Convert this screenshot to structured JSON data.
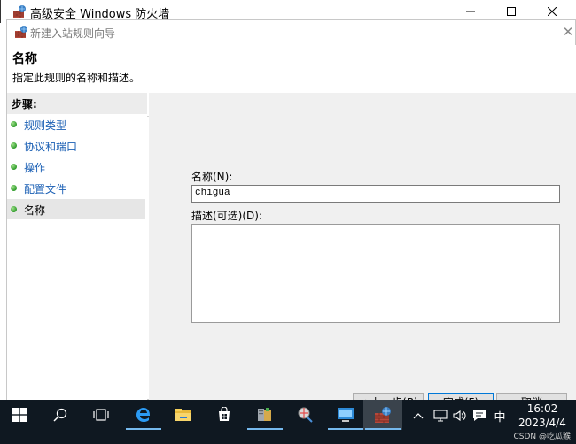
{
  "outer_window": {
    "title": "高级安全 Windows 防火墙",
    "minimize_glyph": "—",
    "maximize_glyph": "☐",
    "close_glyph": "✕"
  },
  "dialog": {
    "title": "新建入站规则向导",
    "close_glyph": "✕",
    "header": {
      "title": "名称",
      "subtitle": "指定此规则的名称和描述。"
    },
    "steps_label": "步骤:",
    "steps": [
      {
        "label": "规则类型",
        "state": "link"
      },
      {
        "label": "协议和端口",
        "state": "link"
      },
      {
        "label": "操作",
        "state": "link"
      },
      {
        "label": "配置文件",
        "state": "link"
      },
      {
        "label": "名称",
        "state": "current"
      }
    ],
    "form": {
      "name_label": "名称(N):",
      "name_value": "chigua",
      "desc_label": "描述(可选)(D):",
      "desc_value": ""
    },
    "buttons": {
      "back": "< 上一步(B)",
      "finish": "完成(F)",
      "cancel": "取消"
    }
  },
  "taskbar": {
    "items": [
      "start-icon",
      "search-icon",
      "task-view-icon",
      "edge-icon",
      "file-explorer-icon",
      "store-icon",
      "server-manager-icon",
      "network-tool-icon",
      "remote-desktop-icon",
      "firewall-icon"
    ],
    "tray": {
      "chevron": "∧",
      "volume": "🕪",
      "ime": "中"
    },
    "clock": {
      "time": "16:02",
      "date": "2023/4/4"
    }
  },
  "watermark": "CSDN @吃瓜猴",
  "colors": {
    "taskbar": "#0f1821",
    "link": "#1a5fb4",
    "accent": "#0078d7",
    "step_dot": "#2e9b2a"
  }
}
